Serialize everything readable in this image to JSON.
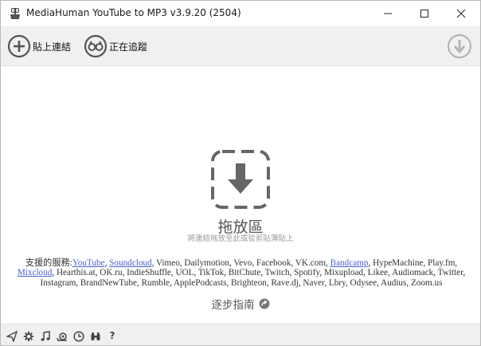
{
  "window": {
    "title": "MediaHuman YouTube to MP3 v3.9.20 (2504)"
  },
  "toolbar": {
    "paste_link_label": "貼上連結",
    "tracking_label": "正在追蹤",
    "icons": [
      "plus-circle-icon",
      "binoculars-icon",
      "download-circle-icon"
    ]
  },
  "dropzone": {
    "title": "拖放區",
    "hint": "將連結拖放至此或從剪貼簿貼上"
  },
  "services": {
    "lead": "支援的服務:",
    "linked": [
      "YouTube",
      "Soundcloud",
      "Bandcamp",
      "Mixcloud"
    ],
    "list_part1": ", Vimeo, Dailymotion, Vevo, Facebook, VK.com, ",
    "list_part2": ", HypeMachine, Play.fm, ",
    "list_part3": ", Hearthis.at, OK.ru, IndieShuffle, UOL, TikTok, BitChute, Twitch, Spotify, Mixupload, Likee, Audiomack, Twitter, Instagram, BrandNewTube, Rumble, ApplePodcasts, Brighteon, Rave.dj, Naver, Lbry, Odysee, Audius, Zoom.us",
    "comma": ", "
  },
  "guide": {
    "label": "逐步指南"
  },
  "statusbar": {
    "icons": [
      "send-icon",
      "settings-icon",
      "music-note-icon",
      "snail-icon",
      "clock-icon",
      "binoculars-icon",
      "help-icon"
    ],
    "help_glyph": "?"
  },
  "colors": {
    "link": "#4a5fcf",
    "toolbar_bg": "#f0f0f0",
    "icon_gray": "#555555",
    "disabled_gray": "#b0b0b0"
  }
}
